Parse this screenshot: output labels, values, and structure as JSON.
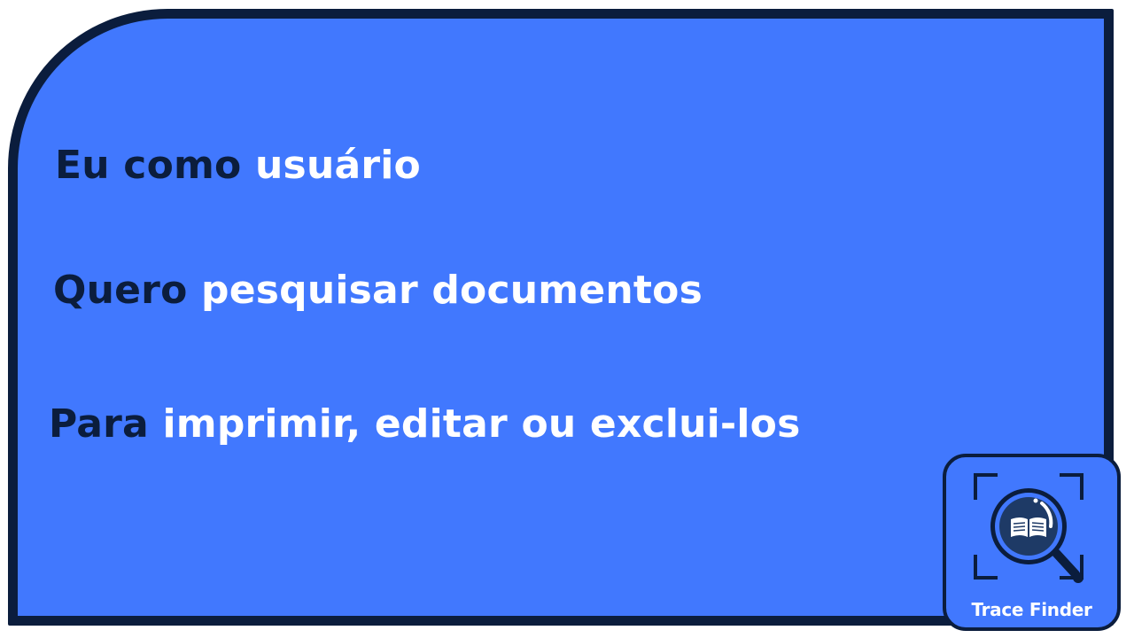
{
  "story": {
    "line1": {
      "lead": "Eu como",
      "rest": "usuário"
    },
    "line2": {
      "lead": "Quero",
      "rest": "pesquisar documentos"
    },
    "line3": {
      "lead": "Para",
      "rest": "imprimir, editar ou exclui-los"
    }
  },
  "logo": {
    "name": "Trace Finder",
    "icon": "magnifier-book-icon"
  },
  "colors": {
    "background": "#4178FE",
    "border": "#0B1D3D",
    "lead_text": "#0B1D3D",
    "rest_text": "#FFFFFF"
  }
}
